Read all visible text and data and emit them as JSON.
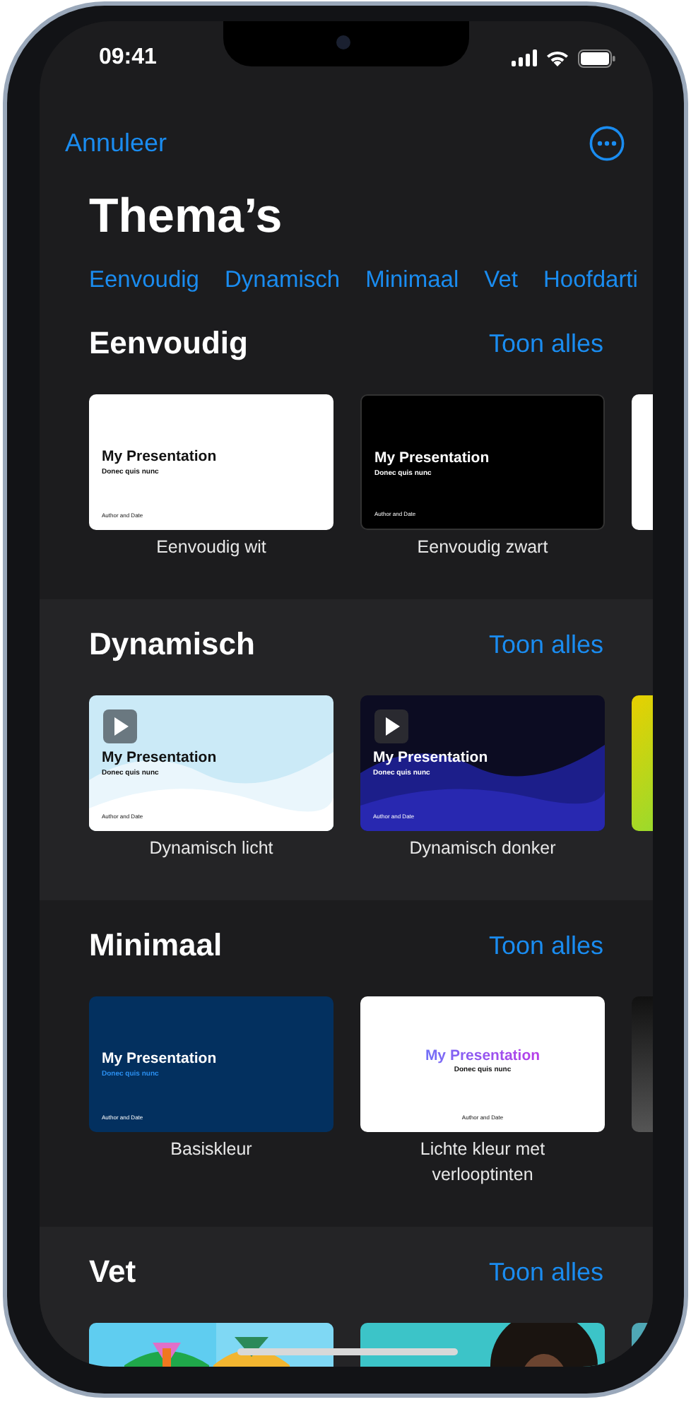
{
  "status_bar": {
    "time": "09:41"
  },
  "nav": {
    "cancel": "Annuleer"
  },
  "title": "Thema’s",
  "categories": [
    {
      "label": "Eenvoudig"
    },
    {
      "label": "Dynamisch"
    },
    {
      "label": "Minimaal"
    },
    {
      "label": "Vet"
    },
    {
      "label": "Hoofdarti"
    }
  ],
  "sections": [
    {
      "title": "Eenvoudig",
      "see_all": "Toon alles",
      "themes": [
        {
          "kind": "plain-white",
          "name": "Eenvoudig wit",
          "slide": {
            "title": "My Presentation",
            "subtitle": "Donec quis nunc",
            "footer": "Author and Date"
          }
        },
        {
          "kind": "plain-black",
          "name": "Eenvoudig zwart",
          "slide": {
            "title": "My Presentation",
            "subtitle": "Donec quis nunc",
            "footer": "Author and Date"
          }
        }
      ],
      "peek": {
        "kind": "plain-white"
      }
    },
    {
      "title": "Dynamisch",
      "see_all": "Toon alles",
      "themes": [
        {
          "kind": "dynamic-light",
          "name": "Dynamisch licht",
          "slide": {
            "title": "My Presentation",
            "subtitle": "Donec quis nunc",
            "footer": "Author and Date"
          }
        },
        {
          "kind": "dynamic-dark",
          "name": "Dynamisch donker",
          "slide": {
            "title": "My Presentation",
            "subtitle": "Donec quis nunc",
            "footer": "Author and Date"
          }
        }
      ],
      "peek": {
        "kind": "dynamic-color"
      }
    },
    {
      "title": "Minimaal",
      "see_all": "Toon alles",
      "themes": [
        {
          "kind": "basic-color",
          "name": "Basiskleur",
          "slide": {
            "title": "My Presentation",
            "subtitle": "Donec quis nunc",
            "footer": "Author and Date"
          }
        },
        {
          "kind": "gradient-light",
          "name": "Lichte kleur met verlooptinten",
          "slide": {
            "title": "My Presentation",
            "subtitle": "Donec quis nunc",
            "footer": "Author and Date"
          }
        }
      ],
      "peek": {
        "kind": "dark"
      }
    },
    {
      "title": "Vet",
      "see_all": "Toon alles",
      "peek": {
        "kind": "teal"
      }
    }
  ]
}
